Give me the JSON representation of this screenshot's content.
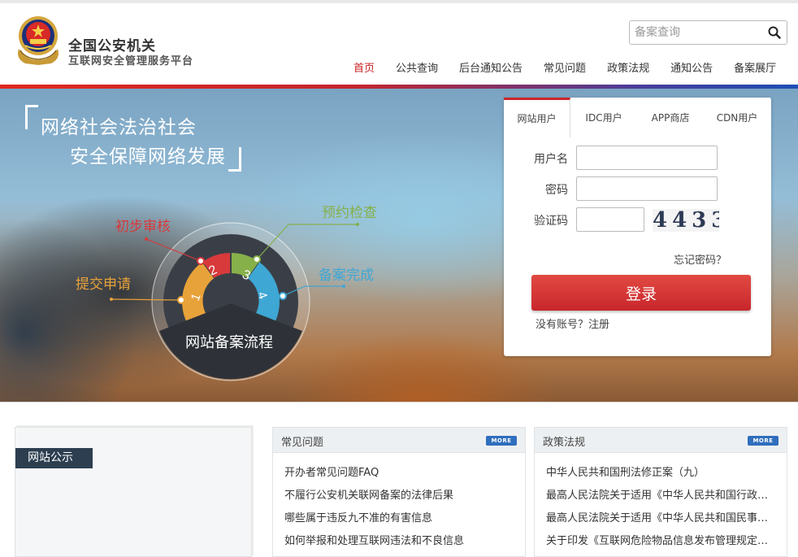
{
  "header": {
    "site_title": "全国公安机关",
    "site_subtitle": "互联网安全管理服务平台",
    "search_placeholder": "备案查询",
    "nav": [
      "首页",
      "公共查询",
      "后台通知公告",
      "常见问题",
      "政策法规",
      "通知公告",
      "备案展厅"
    ]
  },
  "banner": {
    "slogan_line1": "网络社会法治社会",
    "slogan_line2": "安全保障网络发展",
    "flow_title": "网站备案流程",
    "steps": [
      {
        "num": "1",
        "label": "提交申请",
        "color": "#e8a23a"
      },
      {
        "num": "2",
        "label": "初步审核",
        "color": "#d8393b"
      },
      {
        "num": "3",
        "label": "预约检查",
        "color": "#86b04a"
      },
      {
        "num": "4",
        "label": "备案完成",
        "color": "#3ea7d4"
      }
    ]
  },
  "login": {
    "tabs": [
      "网站用户",
      "IDC用户",
      "APP商店",
      "CDN用户"
    ],
    "username_label": "用户名",
    "password_label": "密码",
    "captcha_label": "验证码",
    "captcha_text": "4433",
    "forgot": "忘记密码？",
    "submit": "登录",
    "register": "没有账号？注册"
  },
  "sections": {
    "notice_title": "网站公示",
    "faq": {
      "title": "常见问题",
      "more": "MORE",
      "items": [
        "开办者常见问题FAQ",
        "不履行公安机关联网备案的法律后果",
        "哪些属于违反九不准的有害信息",
        "如何举报和处理互联网违法和不良信息"
      ]
    },
    "policy": {
      "title": "政策法规",
      "more": "MORE",
      "items": [
        "中华人民共和国刑法修正案（九）",
        "最高人民法院关于适用《中华人民共和国行政诉讼法》的解释",
        "最高人民法院关于适用《中华人民共和国民事诉讼法》的解释",
        "关于印发《互联网危险物品信息发布管理规定》的通知"
      ]
    }
  },
  "colors": {
    "brand_red": "#c81e1e",
    "nav_active": "#c81e1e",
    "button_red": "#d0302d",
    "more_blue": "#2f6ebd",
    "notice_navy": "#2c3e50"
  }
}
